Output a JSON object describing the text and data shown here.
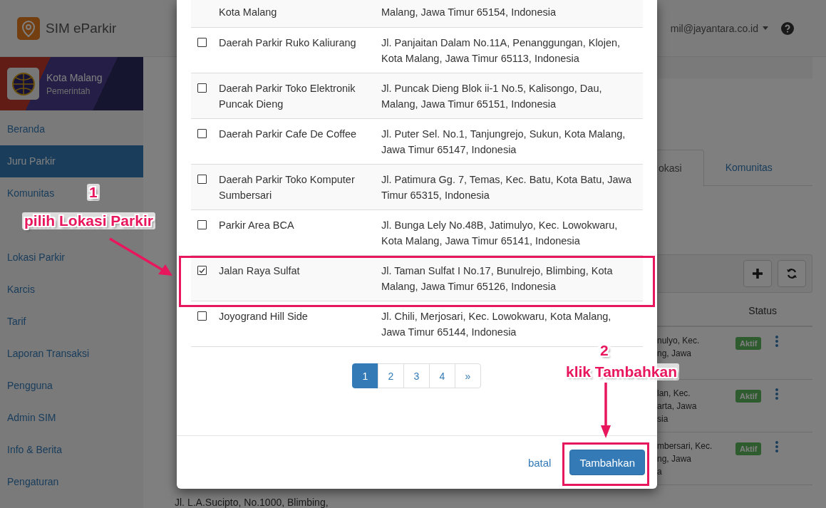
{
  "header": {
    "app_name": "SIM eParkir",
    "user_email": "mil@jayantara.co.id"
  },
  "sidebar": {
    "profile": {
      "name": "Kota Malang",
      "role": "Pemerintah"
    },
    "items": [
      {
        "label": "Beranda",
        "selected": false
      },
      {
        "label": "Juru Parkir",
        "selected": true
      },
      {
        "label": "Komunitas",
        "selected": false
      },
      {
        "label": "Lokasi Parkir",
        "selected": false
      },
      {
        "label": "Karcis",
        "selected": false
      },
      {
        "label": "Tarif",
        "selected": false
      },
      {
        "label": "Laporan Transaksi",
        "selected": false
      },
      {
        "label": "Pengguna",
        "selected": false
      },
      {
        "label": "Admin SIM",
        "selected": false
      },
      {
        "label": "Info & Berita",
        "selected": false
      },
      {
        "label": "Pengaturan",
        "selected": false
      }
    ]
  },
  "background": {
    "tabs": [
      {
        "label": "okasi",
        "selected": true
      },
      {
        "label": "Komunitas",
        "selected": false
      }
    ],
    "table": {
      "columns": [
        "Status"
      ],
      "rows": [
        {
          "address_lines": [
            "nulyo, Kec.",
            "ng, Jawa"
          ],
          "status": "Aktif"
        },
        {
          "address_lines": [
            "lan, Kec.",
            "arta, Jawa",
            "sia"
          ],
          "status": "Aktif"
        },
        {
          "address_lines": [
            "mbersari, Kec.",
            "ng, Jawa",
            "a"
          ],
          "status": "Aktif"
        }
      ]
    },
    "bottom_text": "Jl. L.A.Sucipto, No.1000, Blimbing,"
  },
  "modal": {
    "cut_row": {
      "name": "Kota Malang",
      "address": "Malang, Jawa Timur 65154, Indonesia"
    },
    "rows": [
      {
        "name": "Daerah Parkir Ruko Kaliurang",
        "address": "Jl. Panjaitan Dalam No.11A, Penanggungan, Klojen, Kota Malang, Jawa Timur 65113, Indonesia",
        "checked": false
      },
      {
        "name": "Daerah Parkir Toko Elektronik Puncak Dieng",
        "address": "Jl. Puncak Dieng Blok ii-1 No.5, Kalisongo, Dau, Malang, Jawa Timur 65151, Indonesia",
        "checked": false
      },
      {
        "name": "Daerah Parkir Cafe De Coffee",
        "address": "Jl. Puter Sel. No.1, Tanjungrejo, Sukun, Kota Malang, Jawa Timur 65147, Indonesia",
        "checked": false
      },
      {
        "name": "Daerah Parkir Toko Komputer Sumbersari",
        "address": "Jl. Patimura Gg. 7, Temas, Kec. Batu, Kota Batu, Jawa Timur 65315, Indonesia",
        "checked": false
      },
      {
        "name": "Parkir Area BCA",
        "address": "Jl. Bunga Lely No.48B, Jatimulyo, Kec. Lowokwaru, Kota Malang, Jawa Timur 65141, Indonesia",
        "checked": false
      },
      {
        "name": "Jalan Raya Sulfat",
        "address": "Jl. Taman Sulfat I No.17, Bunulrejo, Blimbing, Kota Malang, Jawa Timur 65126, Indonesia",
        "checked": true
      },
      {
        "name": "Joyogrand Hill Side",
        "address": "Jl. Chili, Merjosari, Kec. Lowokwaru, Kota Malang, Jawa Timur 65144, Indonesia",
        "checked": false
      }
    ],
    "pagination": {
      "pages": [
        {
          "label": "1",
          "selected": true
        },
        {
          "label": "2",
          "selected": false
        },
        {
          "label": "3",
          "selected": false
        },
        {
          "label": "4",
          "selected": false
        }
      ],
      "next": "»"
    },
    "cancel": "batal",
    "submit": "Tambahkan"
  },
  "annotations": [
    {
      "number": "1",
      "text": "pilih Lokasi Parkir"
    },
    {
      "number": "2",
      "text": "klik Tambahkan"
    }
  ]
}
